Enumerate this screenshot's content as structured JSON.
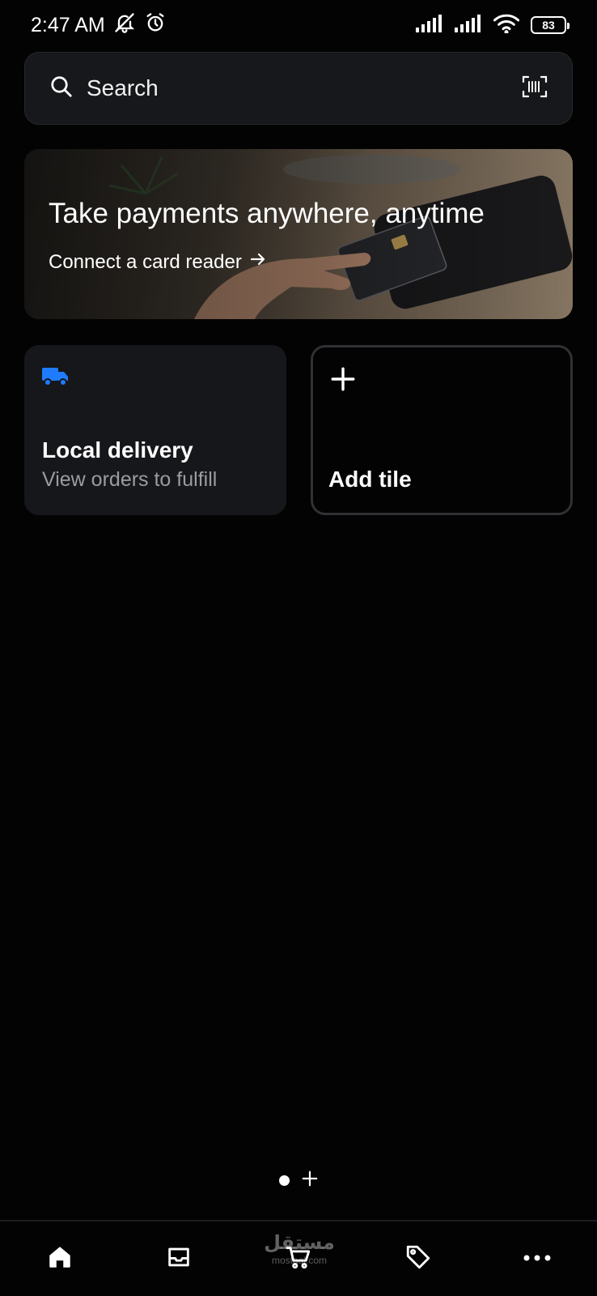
{
  "status_bar": {
    "time": "2:47 AM",
    "battery": "83",
    "icons": [
      "bell-off-icon",
      "alarm-icon",
      "signal-icon",
      "signal-icon",
      "wifi-icon",
      "battery-icon"
    ]
  },
  "search": {
    "label": "Search",
    "search_icon": "search-icon",
    "scan_icon": "barcode-scan-icon"
  },
  "banner": {
    "title": "Take payments anywhere, anytime",
    "link_label": "Connect a card reader",
    "link_icon": "arrow-right-icon"
  },
  "tiles": [
    {
      "icon": "truck-icon",
      "icon_color": "#1f7cff",
      "title": "Local delivery",
      "subtitle": "View orders to fulfill"
    },
    {
      "icon": "plus-icon",
      "title": "Add tile"
    }
  ],
  "page_indicator": {
    "pages": 1,
    "current": 1,
    "add_icon": "plus-icon"
  },
  "bottom_nav": {
    "items": [
      {
        "name": "home",
        "icon": "home-icon",
        "active": true
      },
      {
        "name": "orders",
        "icon": "inbox-icon",
        "active": false
      },
      {
        "name": "cart",
        "icon": "cart-icon",
        "active": false
      },
      {
        "name": "products",
        "icon": "tag-icon",
        "active": false
      },
      {
        "name": "more",
        "icon": "more-icon",
        "active": false
      }
    ],
    "accent_color": "#1f5cff"
  },
  "watermark": {
    "arabic": "مستقل",
    "latin": "mostaql.com"
  }
}
